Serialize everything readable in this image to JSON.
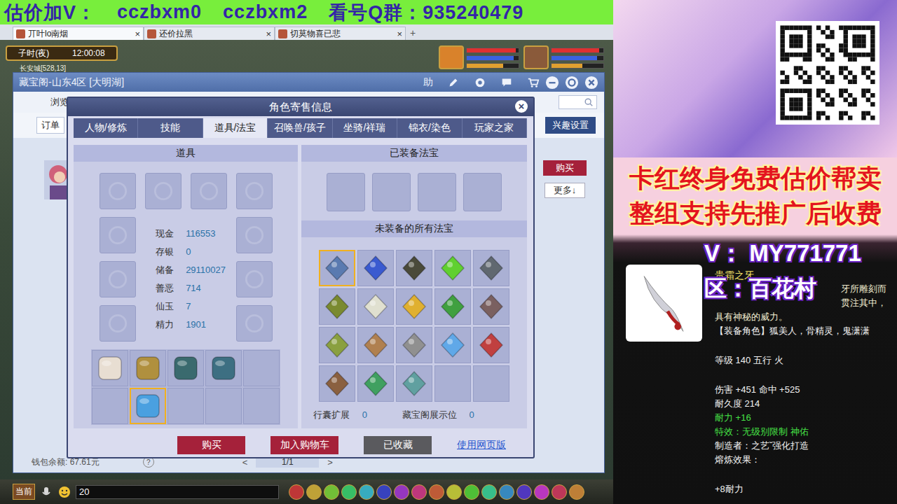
{
  "banner": {
    "segments": [
      "估价加V：",
      "cczbxm0",
      "cczbxm2",
      "看号Q群：935240479"
    ]
  },
  "browser_tabs": [
    {
      "label": "丌叶lo南烟",
      "close": "×",
      "selected": true
    },
    {
      "label": "还价拉黑",
      "close": "×",
      "selected": false
    },
    {
      "label": "切莫物喜已悲",
      "close": "×",
      "selected": false
    }
  ],
  "new_tab": "+",
  "hud": {
    "time_label": "子时(夜)",
    "clock": "12:00:08",
    "location": "长安城[528,13]",
    "portraits": [
      {
        "color": "#d9822b",
        "bars": [
          {
            "level": 0.95,
            "color": "#e03030"
          },
          {
            "level": 0.9,
            "color": "#3a62e0"
          },
          {
            "level": 0.7,
            "color": "#e0a030"
          }
        ]
      },
      {
        "color": "#8a5a3a",
        "bars": [
          {
            "level": 0.92,
            "color": "#e03030"
          },
          {
            "level": 0.88,
            "color": "#3a62e0"
          },
          {
            "level": 0.6,
            "color": "#e0a030"
          }
        ]
      }
    ]
  },
  "cbg_window": {
    "title": "藏宝阁-山东4区 [大明湖]",
    "help": "助",
    "nav_tab": "浏览",
    "order_button": "订单",
    "interest_button": "兴趣设置",
    "buy_button": "购买",
    "more_button": "更多↓",
    "wallet": "钱包余额: 67.61元",
    "wallet_help": "?",
    "pager": {
      "prev": "<",
      "page": "1/1",
      "next": ">"
    }
  },
  "dialog": {
    "title": "角色寄售信息",
    "close": "×",
    "tabs": [
      {
        "label": "人物/修炼",
        "selected": false
      },
      {
        "label": "技能",
        "selected": false
      },
      {
        "label": "道具/法宝",
        "selected": true
      },
      {
        "label": "召唤兽/孩子",
        "selected": false
      },
      {
        "label": "坐骑/祥瑞",
        "selected": false
      },
      {
        "label": "锦衣/染色",
        "selected": false
      },
      {
        "label": "玩家之家",
        "selected": false
      }
    ],
    "items_panel": {
      "title": "道具",
      "equipment_slots": [
        {
          "filled": false
        },
        {
          "filled": false
        },
        {
          "filled": false
        },
        {
          "filled": false
        },
        {
          "filled": false
        },
        {
          "filled": false
        },
        {
          "filled": false
        },
        {
          "filled": false
        },
        {
          "filled": false
        },
        {
          "filled": false
        }
      ],
      "stats": [
        {
          "label": "现金",
          "value": "116553"
        },
        {
          "label": "存银",
          "value": "0"
        },
        {
          "label": "储备",
          "value": "29110027"
        },
        {
          "label": "善恶",
          "value": "714"
        },
        {
          "label": "仙玉",
          "value": "7"
        },
        {
          "label": "精力",
          "value": "1901"
        }
      ],
      "bag": [
        {
          "filled": true,
          "selected": false,
          "color": "#e8ded2"
        },
        {
          "filled": true,
          "selected": false,
          "color": "#b0903e"
        },
        {
          "filled": true,
          "selected": false,
          "color": "#3a6a6e"
        },
        {
          "filled": true,
          "selected": false,
          "color": "#3d6f82"
        },
        {
          "filled": false,
          "selected": false
        },
        {
          "filled": false,
          "selected": false
        },
        {
          "filled": true,
          "selected": true,
          "color": "#4aa0e0"
        },
        {
          "filled": false,
          "selected": false
        },
        {
          "filled": false,
          "selected": false
        },
        {
          "filled": false,
          "selected": false
        }
      ]
    },
    "fabao_panel": {
      "equipped_title": "已装备法宝",
      "equipped_slots": [
        {
          "filled": false
        },
        {
          "filled": false
        },
        {
          "filled": false
        },
        {
          "filled": false
        }
      ],
      "unequipped_title": "未装备的所有法宝",
      "items": [
        {
          "filled": true,
          "selected": true,
          "color": "#5a7ab0"
        },
        {
          "filled": true,
          "selected": false,
          "color": "#3a5ad0"
        },
        {
          "filled": true,
          "selected": false,
          "color": "#4a4a3a"
        },
        {
          "filled": true,
          "selected": false,
          "color": "#60d030"
        },
        {
          "filled": true,
          "selected": false,
          "color": "#606870"
        },
        {
          "filled": true,
          "selected": false,
          "color": "#7a8a30"
        },
        {
          "filled": true,
          "selected": false,
          "color": "#e0e0d0"
        },
        {
          "filled": true,
          "selected": false,
          "color": "#e0b030"
        },
        {
          "filled": true,
          "selected": false,
          "color": "#40a040"
        },
        {
          "filled": true,
          "selected": false,
          "color": "#7a6060"
        },
        {
          "filled": true,
          "selected": false,
          "color": "#8aa040"
        },
        {
          "filled": true,
          "selected": false,
          "color": "#b08050"
        },
        {
          "filled": true,
          "selected": false,
          "color": "#909090"
        },
        {
          "filled": true,
          "selected": false,
          "color": "#60a8e8"
        },
        {
          "filled": true,
          "selected": false,
          "color": "#c04040"
        },
        {
          "filled": true,
          "selected": false,
          "color": "#8a6040"
        },
        {
          "filled": true,
          "selected": false,
          "color": "#40a060"
        },
        {
          "filled": true,
          "selected": false,
          "color": "#60a0a0"
        },
        {
          "filled": false,
          "selected": false
        },
        {
          "filled": false,
          "selected": false
        }
      ],
      "footer": [
        {
          "label": "行囊扩展",
          "value": "0"
        },
        {
          "label": "藏宝阁展示位",
          "value": "0"
        }
      ]
    },
    "buttons": [
      {
        "label": "购买",
        "kind": "primary"
      },
      {
        "label": "加入购物车",
        "kind": "primary"
      },
      {
        "label": "已收藏",
        "kind": "muted"
      },
      {
        "label": "使用网页版",
        "kind": "link"
      }
    ]
  },
  "chat": {
    "channel": "当前",
    "input": "20"
  },
  "promo": {
    "slogans": [
      "卡红终身免费估价帮卖",
      "整组支持先推广后收费"
    ]
  },
  "item_tooltip": {
    "contact": "V： MY771771",
    "server": "区：百花村",
    "name": "贵霜之牙",
    "description": [
      {
        "text": "牙所雕刻而",
        "covered": true
      },
      {
        "text": "贯注其中，",
        "covered": true
      },
      {
        "text": "具有神秘的威力。",
        "covered": false
      }
    ],
    "lines": [
      {
        "text": "【装备角色】狐美人，骨精灵，鬼潇潇",
        "color": "#f2f2f2",
        "kind": "line"
      },
      {
        "text": "等级 140 五行 火",
        "color": "#f2f2f2",
        "kind": "section"
      },
      {
        "text": "伤害 +451 命中 +525",
        "color": "#f2f2f2",
        "kind": "section"
      },
      {
        "text": "耐久度 214",
        "color": "#f2f2f2",
        "kind": "line"
      },
      {
        "text": "耐力 +16",
        "color": "#46e046",
        "kind": "line"
      },
      {
        "text": "特效：无级别限制 神佑",
        "color": "#46e046",
        "kind": "line"
      },
      {
        "text": "制造者：之艺ˇ强化打造",
        "color": "#f2f2f2",
        "kind": "line"
      },
      {
        "text": "熔炼效果：",
        "color": "#f2f2f2",
        "kind": "line"
      },
      {
        "text": "+8耐力",
        "color": "#f2f2f2",
        "kind": "section"
      }
    ]
  }
}
